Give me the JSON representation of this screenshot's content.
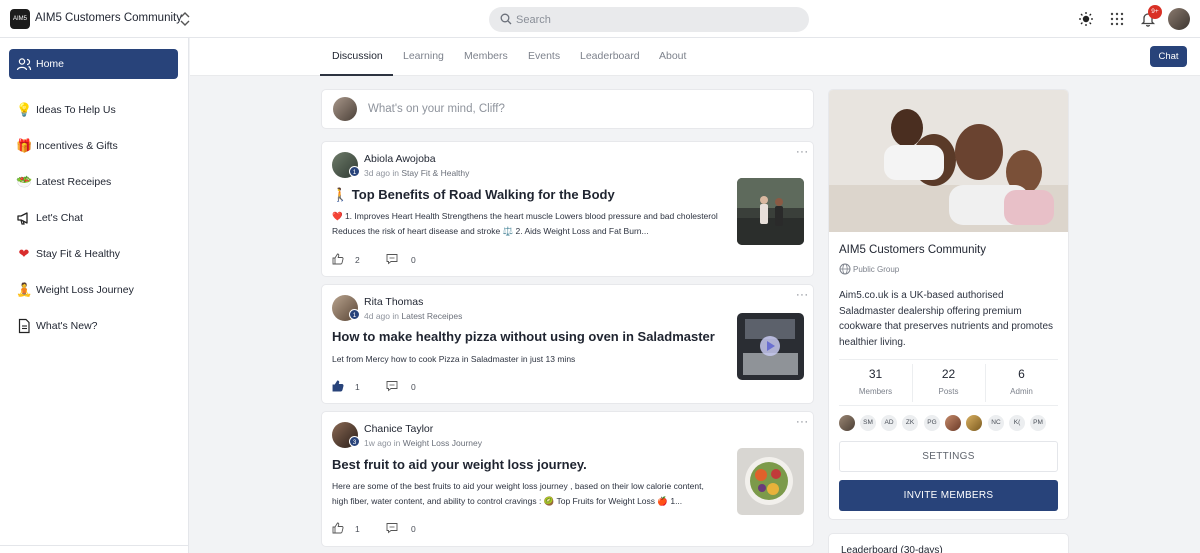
{
  "app": {
    "logo_text": "AIM5",
    "title": "AIM5 Customers Community",
    "notification_count": "9+"
  },
  "search": {
    "placeholder": "Search"
  },
  "sidebar": {
    "items": [
      {
        "label": "Home",
        "icon": "users-icon",
        "active": true
      },
      {
        "label": "Ideas To Help Us",
        "icon": "lightbulb-icon"
      },
      {
        "label": "Incentives & Gifts",
        "icon": "gift-icon"
      },
      {
        "label": "Latest Receipes",
        "icon": "salad-icon"
      },
      {
        "label": "Let's Chat",
        "icon": "megaphone-icon"
      },
      {
        "label": "Stay Fit & Healthy",
        "icon": "heart-icon"
      },
      {
        "label": "Weight Loss Journey",
        "icon": "meditation-icon"
      },
      {
        "label": "What's New?",
        "icon": "document-icon"
      }
    ]
  },
  "tabs": [
    "Discussion",
    "Learning",
    "Members",
    "Events",
    "Leaderboard",
    "About"
  ],
  "active_tab": "Discussion",
  "chat_label": "Chat",
  "composer": {
    "placeholder": "What's on your mind, Cliff?"
  },
  "posts": [
    {
      "author": "Abiola Awojoba",
      "level": "1",
      "time": "3d ago",
      "in_word": "in",
      "space": "Stay Fit & Healthy",
      "title": "🚶 Top Benefits of Road Walking for the Body",
      "excerpt": "❤️ 1. Improves Heart Health Strengthens the heart muscle Lowers blood pressure and bad cholesterol Reduces the risk of heart disease and stroke ⚖️ 2. Aids Weight Loss and Fat Burn...",
      "likes": "2",
      "comments": "0",
      "liked": false
    },
    {
      "author": "Rita Thomas",
      "level": "1",
      "time": "4d ago",
      "in_word": "in",
      "space": "Latest Receipes",
      "title": "How to make healthy pizza without using oven in Saladmaster",
      "excerpt": "Let from Mercy how to cook Pizza in Saladmaster in just 13 mins",
      "likes": "1",
      "comments": "0",
      "liked": true
    },
    {
      "author": "Chanice Taylor",
      "level": "3",
      "time": "1w ago",
      "in_word": "in",
      "space": "Weight Loss Journey",
      "title": "Best fruit to aid your weight loss journey.",
      "excerpt": "Here are some of the best fruits to aid your weight loss journey , based on their low calorie content, high fiber, water content, and ability to control cravings : 🥝 Top Fruits for Weight Loss 🍎 1...",
      "likes": "1",
      "comments": "0",
      "liked": false
    }
  ],
  "group": {
    "title": "AIM5 Customers Community",
    "type": "Public Group",
    "description": "Aim5.co.uk is a UK-based authorised Saladmaster dealership offering premium cookware that preserves nutrients and promotes healthier living.",
    "stats": [
      {
        "value": "31",
        "label": "Members"
      },
      {
        "value": "22",
        "label": "Posts"
      },
      {
        "value": "6",
        "label": "Admin"
      }
    ],
    "member_avatars": [
      "",
      "SM",
      "AD",
      "ZK",
      "PG",
      "",
      "",
      "NC",
      "K(",
      "PM"
    ],
    "settings_label": "SETTINGS",
    "invite_label": "INVITE MEMBERS"
  },
  "leaderboard": {
    "title": "Leaderboard (30-days)"
  }
}
